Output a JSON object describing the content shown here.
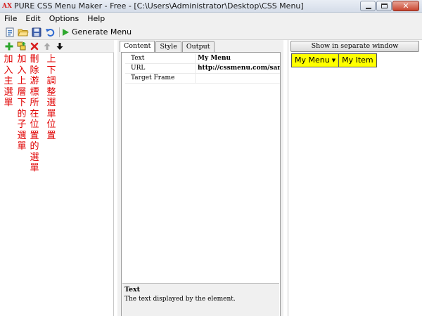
{
  "window": {
    "app_icon": "AX",
    "title": "PURE CSS Menu Maker - Free - [C:\\Users\\Administrator\\Desktop\\CSS Menu]"
  },
  "menubar": {
    "items": [
      "File",
      "Edit",
      "Options",
      "Help"
    ]
  },
  "toolbar": {
    "icons": [
      "new-page-icon",
      "open-folder-icon",
      "save-disk-icon",
      "undo-icon",
      "play-icon"
    ],
    "generate_label": "Generate Menu"
  },
  "left_panel": {
    "icons": [
      "add-plus-icon",
      "add-sub-icon",
      "delete-x-icon",
      "move-up-icon",
      "move-down-icon"
    ],
    "annotations": [
      "加入主選單",
      "加入上層下的子選單",
      "刪除游標所在位置的選單",
      "上下調整選單位置"
    ],
    "annotation_color": "#e00000"
  },
  "properties": {
    "tabs": [
      "Content",
      "Style",
      "Output"
    ],
    "rows": [
      {
        "name": "Text",
        "value": "My Menu"
      },
      {
        "name": "URL",
        "value": "http://cssmenu.com/sample/p"
      },
      {
        "name": "Target Frame",
        "value": ""
      }
    ],
    "description_title": "Text",
    "description_text": "The text displayed by the element."
  },
  "preview": {
    "button_label": "Show in separate window",
    "menu_items": [
      "My Menu",
      "My Item"
    ],
    "menu_color": "#ffff00"
  }
}
